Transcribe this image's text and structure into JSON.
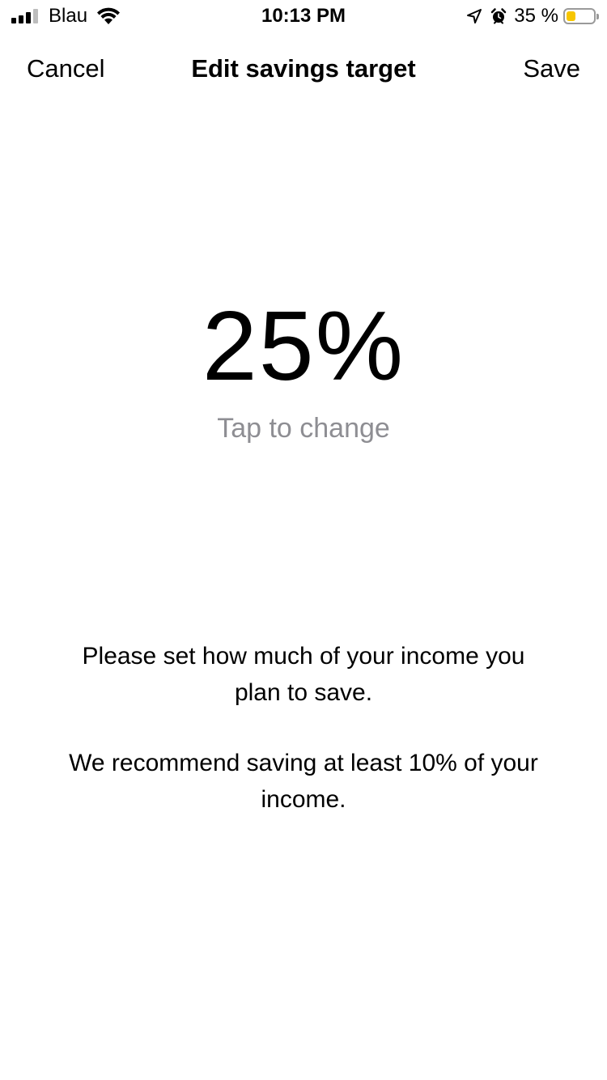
{
  "status_bar": {
    "carrier": "Blau",
    "time": "10:13 PM",
    "battery_percent": "35 %",
    "battery_level": 0.35,
    "battery_color": "#f7c600",
    "icons": [
      "signal-icon",
      "wifi-icon",
      "location-arrow-icon",
      "alarm-icon",
      "battery-icon"
    ]
  },
  "nav": {
    "cancel_label": "Cancel",
    "title": "Edit savings target",
    "save_label": "Save"
  },
  "target": {
    "value": "25%",
    "hint": "Tap to change",
    "hint_color": "#8e8e93"
  },
  "info": {
    "paragraph_1": "Please set how much of your income you plan to save.",
    "paragraph_2": "We recommend saving at least 10% of your income."
  }
}
